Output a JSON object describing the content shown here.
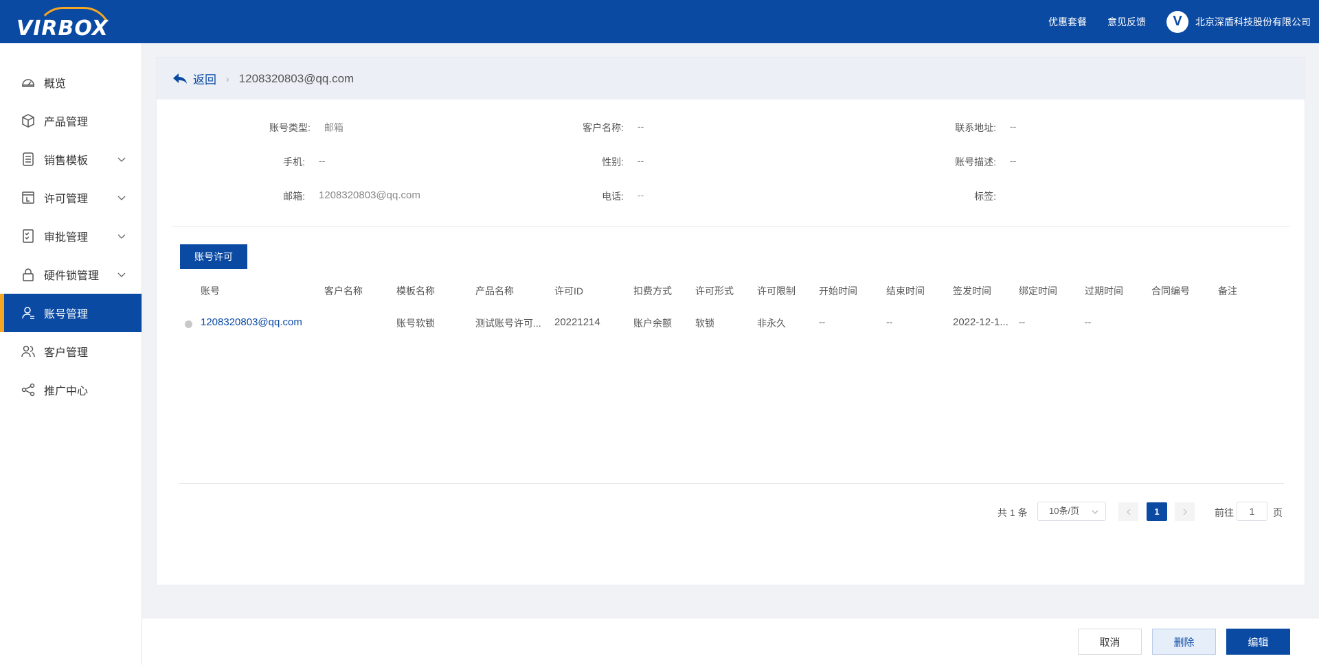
{
  "header": {
    "logo_text": "VIRBOX",
    "links": [
      "优惠套餐",
      "意见反馈"
    ],
    "company": "北京深盾科技股份有限公司"
  },
  "sidebar": {
    "items": [
      {
        "label": "概览",
        "icon": "dashboard-icon"
      },
      {
        "label": "产品管理",
        "icon": "box-icon"
      },
      {
        "label": "销售模板",
        "icon": "template-icon"
      },
      {
        "label": "许可管理",
        "icon": "license-icon"
      },
      {
        "label": "审批管理",
        "icon": "approval-icon"
      },
      {
        "label": "硬件锁管理",
        "icon": "lock-icon"
      },
      {
        "label": "账号管理",
        "icon": "user-icon"
      },
      {
        "label": "客户管理",
        "icon": "customers-icon"
      },
      {
        "label": "推广中心",
        "icon": "share-icon"
      }
    ],
    "active": "账号管理"
  },
  "breadcrumb": {
    "back": "返回",
    "current": "1208320803@qq.com"
  },
  "info": {
    "account_type_label": "账号类型:",
    "account_type": "邮箱",
    "customer_name_label": "客户名称:",
    "customer_name": "--",
    "address_label": "联系地址:",
    "address": "--",
    "mobile_label": "手机:",
    "mobile": "--",
    "gender_label": "性别:",
    "gender": "--",
    "desc_label": "账号描述:",
    "desc": "--",
    "email_label": "邮箱:",
    "email": "1208320803@qq.com",
    "phone_label": "电话:",
    "phone": "--",
    "tags_label": "标签:",
    "tags": ""
  },
  "tab": "账号许可",
  "table": {
    "headers": [
      "账号",
      "客户名称",
      "模板名称",
      "产品名称",
      "许可ID",
      "扣费方式",
      "许可形式",
      "许可限制",
      "开始时间",
      "结束时间",
      "签发时间",
      "绑定时间",
      "过期时间",
      "合同编号",
      "备注"
    ],
    "rows": [
      [
        "1208320803@qq.com",
        "",
        "账号软锁",
        "测试账号许可...",
        "20221214",
        "账户余额",
        "软锁",
        "非永久",
        "--",
        "--",
        "2022-12-1...",
        "--",
        "--",
        "",
        ""
      ]
    ]
  },
  "pager": {
    "total": "共 1 条",
    "page_size": "10条/页",
    "current": "1",
    "goto_label": "前往",
    "goto_value": "1",
    "page_label": "页"
  },
  "actions": {
    "cancel": "取消",
    "delete": "删除",
    "edit": "编辑"
  },
  "colors": {
    "brand": "#0a4aa3",
    "accent": "#f5a623"
  }
}
